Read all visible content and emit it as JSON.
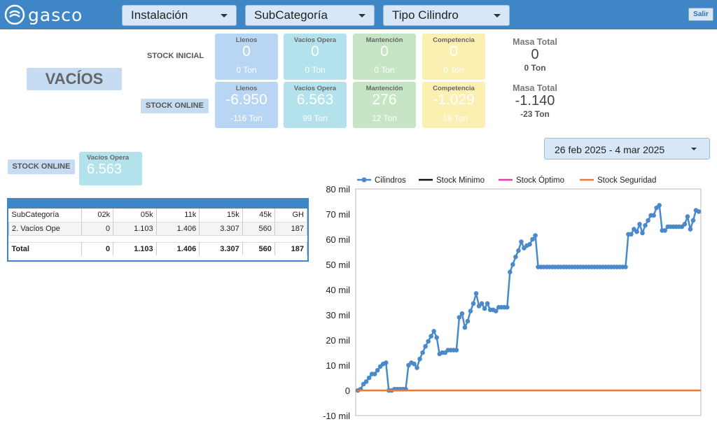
{
  "header": {
    "logo_text": "gasco",
    "filters": [
      "Instalación",
      "SubCategoría",
      "Tipo Cilindro"
    ],
    "exit_label": "Salir"
  },
  "section_title": "VACÍOS",
  "stock_inicial": {
    "label": "STOCK INICIAL",
    "cards": [
      {
        "title": "Llenos",
        "value": "0",
        "sub": "0 Ton"
      },
      {
        "title": "Vacíos Opera",
        "value": "0",
        "sub": "0 Ton"
      },
      {
        "title": "Mantención",
        "value": "0",
        "sub": "0 Ton"
      },
      {
        "title": "Competencia",
        "value": "0",
        "sub": "0 Ton"
      }
    ],
    "masa": {
      "title": "Masa Total",
      "value": "0",
      "sub": "0 Ton"
    }
  },
  "stock_online": {
    "label": "STOCK ONLINE",
    "cards": [
      {
        "title": "Llenos",
        "value": "-6.950",
        "sub": "-116 Ton"
      },
      {
        "title": "Vacíos Opera",
        "value": "6.563",
        "sub": "99 Ton"
      },
      {
        "title": "Mantención",
        "value": "276",
        "sub": "12 Ton"
      },
      {
        "title": "Competencia",
        "value": "-1.029",
        "sub": "-18 Ton"
      }
    ],
    "masa": {
      "title": "Masa Total",
      "value": "-1.140",
      "sub": "-23 Ton"
    }
  },
  "stock_online_small": {
    "label": "STOCK ONLINE",
    "card_title": "Vacíos Opera",
    "card_value": "6.563"
  },
  "date_range": "26 feb 2025 - 4 mar 2025",
  "table": {
    "columns": [
      "SubCategoría",
      "02k",
      "05k",
      "11k",
      "15k",
      "45k",
      "GH"
    ],
    "rows": [
      [
        "2. Vacíos Ope",
        "0",
        "1.103",
        "1.406",
        "3.307",
        "560",
        "187"
      ]
    ],
    "total": [
      "Total",
      "0",
      "1.103",
      "1.406",
      "3.307",
      "560",
      "187"
    ]
  },
  "colors": {
    "header": "#3f86c7",
    "cilindros": "#4a8acb",
    "minimo": "#111111",
    "optimo": "#e83ca0",
    "seguridad": "#f07a32"
  },
  "chart_data": {
    "type": "line",
    "title": "",
    "xlabel": "",
    "ylabel": "",
    "ylim": [
      -10000,
      80000
    ],
    "y_ticks": [
      "80 mil",
      "70 mil",
      "60 mil",
      "50 mil",
      "40 mil",
      "30 mil",
      "20 mil",
      "10 mil",
      "0",
      "-10 mil"
    ],
    "legend": [
      "Cilindros",
      "Stock Minimo",
      "Stock Óptimo",
      "Stock Seguridad"
    ],
    "legend_position": "top",
    "series": [
      {
        "name": "Cilindros",
        "values": [
          0,
          500,
          2500,
          3500,
          5000,
          6500,
          6500,
          8000,
          9500,
          10500,
          11000,
          0,
          0,
          500,
          500,
          500,
          500,
          500,
          10000,
          11000,
          10500,
          9000,
          12500,
          15000,
          17500,
          19500,
          21500,
          23500,
          21000,
          14500,
          15000,
          15000,
          16000,
          16000,
          16000,
          16000,
          29000,
          30500,
          25000,
          27500,
          31500,
          34500,
          38500,
          33500,
          34500,
          32500,
          34500,
          32000,
          32000,
          31500,
          33000,
          33000,
          33000,
          33000,
          47000,
          50000,
          53000,
          55500,
          59000,
          56500,
          57500,
          58000,
          60000,
          61500,
          49000,
          49000,
          49000,
          49000,
          49000,
          49000,
          49000,
          49000,
          49000,
          49000,
          49000,
          49000,
          49000,
          49000,
          49000,
          49000,
          49000,
          49000,
          49000,
          49000,
          49000,
          49000,
          49000,
          49000,
          49000,
          49000,
          49000,
          49000,
          49000,
          49000,
          49000,
          49000,
          62000,
          62000,
          64000,
          63000,
          66000,
          62500,
          65500,
          67500,
          69500,
          69500,
          72500,
          73500,
          63500,
          63500,
          65000,
          65000,
          65000,
          65000,
          65000,
          65000,
          66000,
          69000,
          64000,
          67500,
          71500,
          71000
        ]
      },
      {
        "name": "Stock Minimo",
        "values": [
          0,
          0
        ]
      },
      {
        "name": "Stock Óptimo",
        "values": [
          0,
          0
        ]
      },
      {
        "name": "Stock Seguridad",
        "values": [
          0,
          0
        ]
      }
    ]
  }
}
